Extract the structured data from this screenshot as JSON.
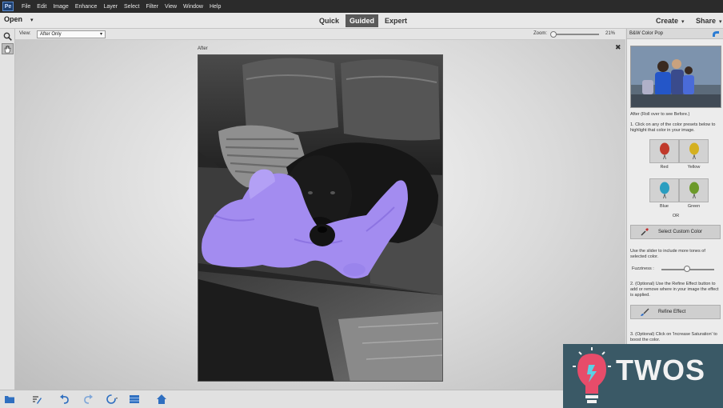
{
  "menu": {
    "items": [
      "File",
      "Edit",
      "Image",
      "Enhance",
      "Layer",
      "Select",
      "Filter",
      "View",
      "Window",
      "Help"
    ]
  },
  "modebar": {
    "open_label": "Open",
    "tabs": [
      {
        "label": "Quick",
        "active": false
      },
      {
        "label": "Guided",
        "active": true
      },
      {
        "label": "Expert",
        "active": false
      }
    ],
    "create_label": "Create",
    "share_label": "Share"
  },
  "options": {
    "view_label": "View:",
    "view_value": "After Only",
    "zoom_label": "Zoom:",
    "zoom_value": "21%",
    "zoom_level": 0.21
  },
  "canvas": {
    "after_label": "After"
  },
  "panel": {
    "title": "B&W Color Pop",
    "after_caption": "After (Roll over to see Before.)",
    "step1": "1. Click on any of the color presets below to highlight that color in your image.",
    "presets": [
      {
        "label": "Red",
        "color": "#c0392b"
      },
      {
        "label": "Yellow",
        "color": "#d4b020"
      },
      {
        "label": "Blue",
        "color": "#2b9ec0"
      },
      {
        "label": "Green",
        "color": "#6c9a2a"
      }
    ],
    "or_label": "OR",
    "custom_color_label": "Select Custom Color",
    "slider_hint": "Use the slider to include more tones of selected color.",
    "fuzziness_label": "Fuzziness :",
    "fuzziness_level": 0.5,
    "step2": "2. (Optional) Use the Refine Effect button to add or remove where in your image the effect is applied.",
    "refine_label": "Refine Effect",
    "step3": "3. (Optional) Click on 'Increase Saturation' to boost the color."
  },
  "watermark": {
    "text": "TWOS"
  },
  "colors": {
    "accent_purple": "#a38cf0",
    "active_tab": "#5a5a5a",
    "menubar": "#2b2b2b"
  }
}
